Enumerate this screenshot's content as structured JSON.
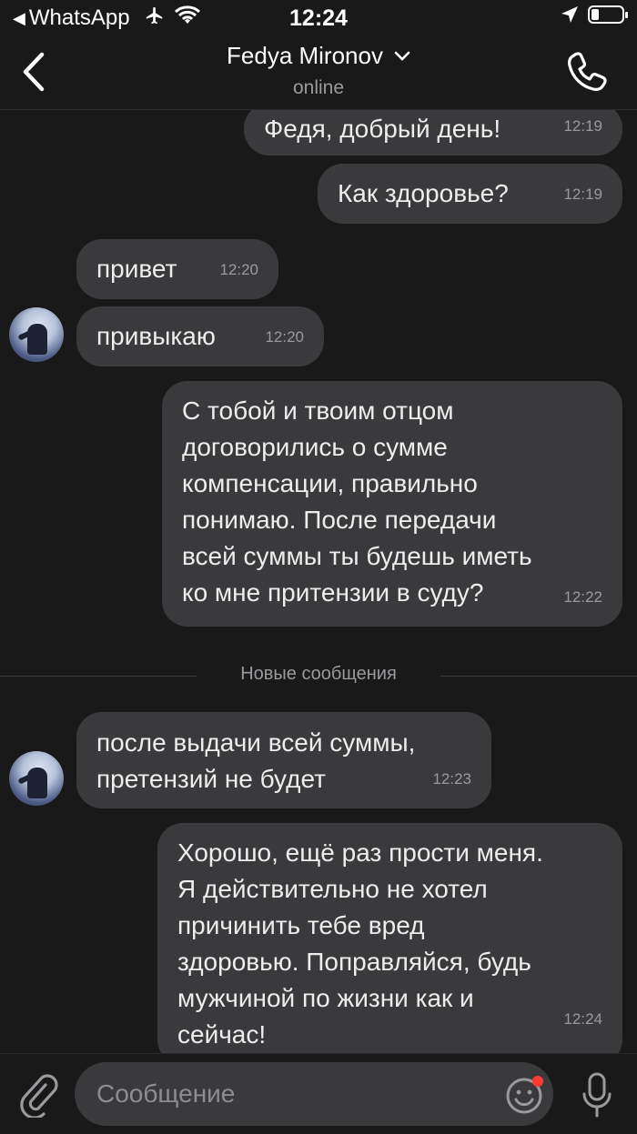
{
  "status_bar": {
    "back_app": "WhatsApp",
    "time": "12:24",
    "battery_level": 0.25
  },
  "header": {
    "contact_name": "Fedya Mironov",
    "status": "online"
  },
  "messages": [
    {
      "direction": "out",
      "text": "Федя, добрый день!",
      "time": "12:19"
    },
    {
      "direction": "out",
      "text": "Как здоровье?",
      "time": "12:19"
    },
    {
      "direction": "in",
      "text": "привет",
      "time": "12:20"
    },
    {
      "direction": "in",
      "text": "привыкаю",
      "time": "12:20"
    },
    {
      "direction": "out",
      "text": "С тобой и твоим отцом\nдоговорились о сумме\nкомпенсации, правильно\nпонимаю. После передачи\nвсей суммы ты будешь иметь\nко мне притензии в суду?",
      "time": "12:22"
    },
    {
      "direction": "in",
      "text": "после выдачи всей суммы,\nпретензий не будет",
      "time": "12:23"
    },
    {
      "direction": "out",
      "text": "Хорошо, ещё раз прости меня.\nЯ действительно не хотел\nпричинить тебе вред\nздоровью. Поправляйся, будь\nмужчиной по жизни как и\nсейчас!",
      "time": "12:24"
    }
  ],
  "divider": {
    "label": "Новые сообщения"
  },
  "input": {
    "placeholder": "Сообщение"
  }
}
